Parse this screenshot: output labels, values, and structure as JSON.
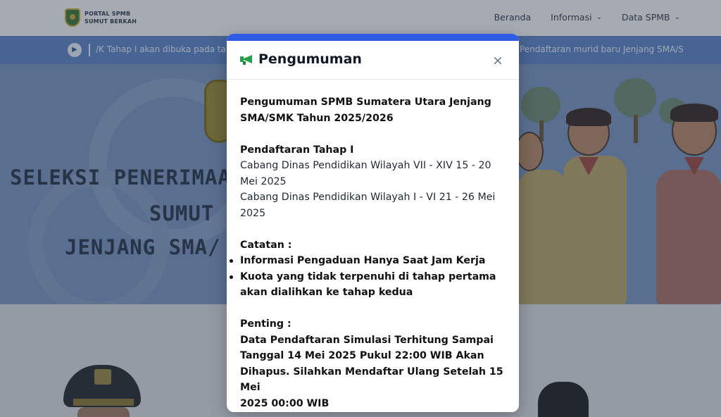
{
  "navbar": {
    "brand_line1": "PORTAL SPMB",
    "brand_line2": "SUMUT BERKAH",
    "menu": [
      {
        "label": "Beranda",
        "has_dropdown": false
      },
      {
        "label": "Informasi",
        "has_dropdown": true
      },
      {
        "label": "Data SPMB",
        "has_dropdown": true
      }
    ]
  },
  "ticker": {
    "icon": "speaker-icon",
    "text_left": "/K Tahap I akan dibuka pada tan",
    "text_right": "Pendaftaran murid baru Jenjang SMA/SM"
  },
  "hero": {
    "title_line1": "SELEKSI PENERIMAAN",
    "title_line2": "SUMUT",
    "title_line3": "JENJANG SMA/"
  },
  "modal": {
    "accent_color": "#2f5be6",
    "icon": "megaphone-icon",
    "title": "Pengumuman",
    "close_label": "×",
    "heading_line1": "Pengumuman SPMB Sumatera Utara Jenjang",
    "heading_line2": "SMA/SMK Tahun 2025/2026",
    "registration": {
      "label": "Pendaftaran Tahap I",
      "line1": "Cabang Dinas Pendidikan Wilayah VII - XIV 15 - 20",
      "line2": "Mei 2025",
      "line3": "Cabang Dinas Pendidikan Wilayah I - VI 21 - 26 Mei",
      "line4": "2025"
    },
    "notes": {
      "label": "Catatan :",
      "item1": "Informasi Pengaduan Hanya Saat Jam Kerja",
      "item2_line1": "Kuota yang tidak terpenuhi di tahap pertama",
      "item2_line2": "akan dialihkan ke tahap kedua"
    },
    "important": {
      "label": "Penting :",
      "line1": "Data Pendaftaran Simulasi Terhitung Sampai",
      "line2": "Tanggal 14 Mei 2025 Pukul 22:00 WIB Akan",
      "line3": "Dihapus. Silahkan Mendaftar Ulang Setelah 15 Mei",
      "line4": "2025 00:00 WIB"
    }
  }
}
